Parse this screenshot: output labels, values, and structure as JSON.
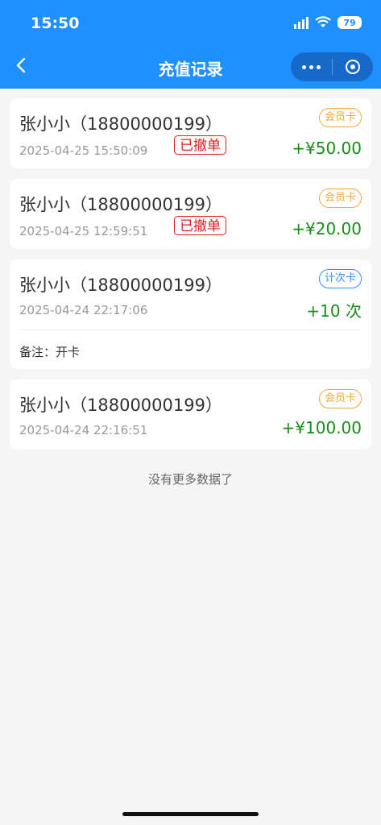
{
  "status_bar": {
    "time": "15:50",
    "battery": "79"
  },
  "nav": {
    "title": "充值记录"
  },
  "records": [
    {
      "name": "张小小（18800000199）",
      "datetime": "2025-04-25 15:50:09",
      "status": "已撤单",
      "tag": "会员卡",
      "amount": "+¥50.00"
    },
    {
      "name": "张小小（18800000199）",
      "datetime": "2025-04-25 12:59:51",
      "status": "已撤单",
      "tag": "会员卡",
      "amount": "+¥20.00"
    },
    {
      "name": "张小小（18800000199）",
      "datetime": "2025-04-24 22:17:06",
      "tag": "计次卡",
      "amount": "+10 次",
      "remark": "备注：开卡"
    },
    {
      "name": "张小小（18800000199）",
      "datetime": "2025-04-24 22:16:51",
      "tag": "会员卡",
      "amount": "+¥100.00"
    }
  ],
  "footer": {
    "no_more": "没有更多数据了"
  },
  "colors": {
    "header": "#1e90ff",
    "amount": "#1a8c1a",
    "revoked": "#e02020",
    "member_tag": "#f3a93b",
    "count_tag": "#3b8ef3"
  }
}
